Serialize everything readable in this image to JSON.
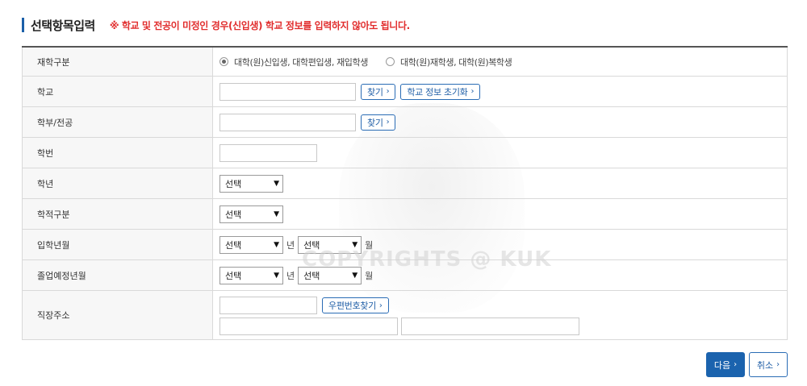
{
  "header": {
    "title": "선택항목입력",
    "notice": "※ 학교 및 전공이 미정인 경우(신입생) 학교 정보를 입력하지 않아도 됩니다."
  },
  "form": {
    "enrollment_type": {
      "label": "재학구분",
      "options": [
        "대학(원)신입생, 대학편입생, 재입학생",
        "대학(원)재학생, 대학(원)복학생"
      ],
      "selected_index": 0
    },
    "school": {
      "label": "학교",
      "value": "",
      "find_button": "찾기",
      "reset_button": "학교 정보 초기화"
    },
    "department": {
      "label": "학부/전공",
      "value": "",
      "find_button": "찾기"
    },
    "student_id": {
      "label": "학번",
      "value": ""
    },
    "grade": {
      "label": "학년",
      "selected": "선택"
    },
    "academic_status": {
      "label": "학적구분",
      "selected": "선택"
    },
    "admission_date": {
      "label": "입학년월",
      "year_selected": "선택",
      "year_unit": "년",
      "month_selected": "선택",
      "month_unit": "월"
    },
    "graduation_date": {
      "label": "졸업예정년월",
      "year_selected": "선택",
      "year_unit": "년",
      "month_selected": "선택",
      "month_unit": "월"
    },
    "work_address": {
      "label": "직장주소",
      "zip_value": "",
      "zip_button": "우편번호찾기",
      "address1": "",
      "address2": ""
    }
  },
  "watermark": "COPYRIGHTS @ KUK",
  "footer": {
    "next_button": "다음",
    "cancel_button": "취소"
  },
  "colors": {
    "accent": "#1b63ae",
    "notice": "#e12d2d"
  },
  "icons": {
    "chevron": "chevron-right-icon",
    "select_arrow": "chevron-down-icon"
  }
}
